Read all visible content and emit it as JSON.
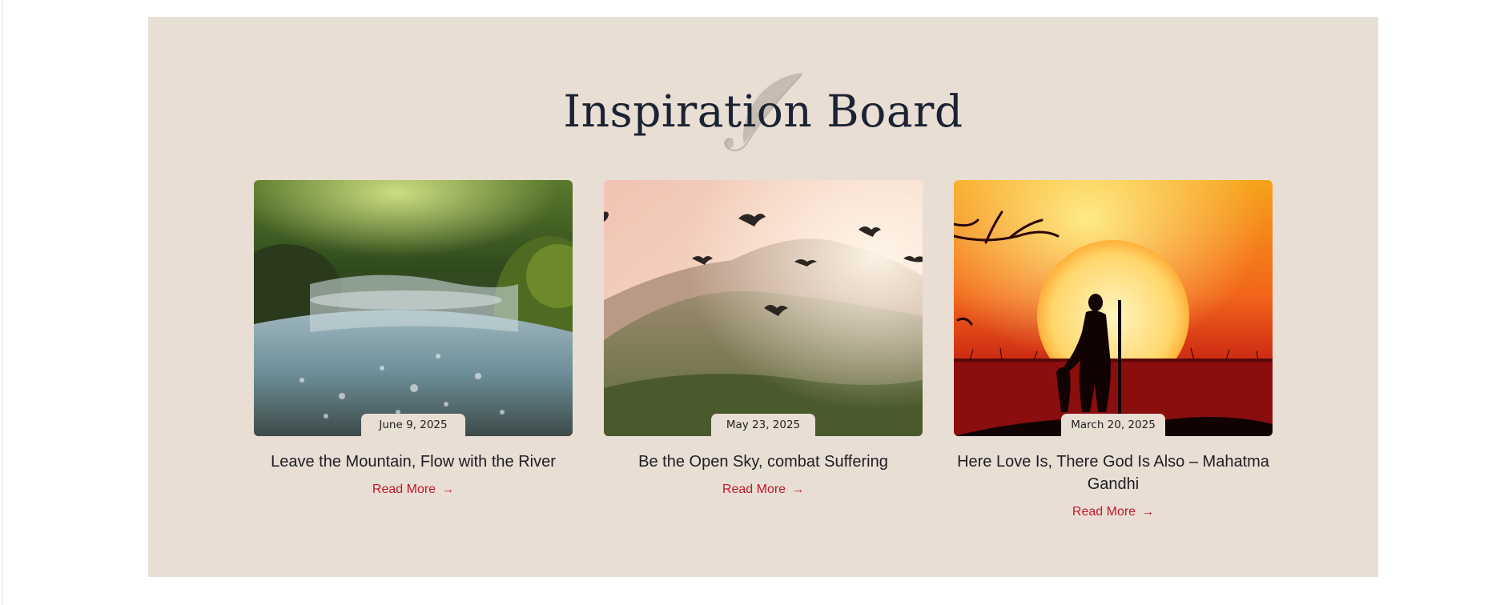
{
  "section": {
    "title": "Inspiration Board",
    "background": "#e9ded4",
    "title_color": "#1b2333",
    "accent_color": "#c2182b"
  },
  "cards": [
    {
      "date": "June 9, 2025",
      "title": "Leave the Mountain, Flow with the River",
      "link_label": "Read More",
      "arrow_icon": "arrow-right-icon"
    },
    {
      "date": "May 23, 2025",
      "title": "Be the Open Sky, combat Suffering",
      "link_label": "Read More",
      "arrow_icon": "arrow-right-icon"
    },
    {
      "date": "March 20, 2025",
      "title": "Here Love Is, There God Is Also – Mahatma Gandhi",
      "link_label": "Read More",
      "arrow_icon": "arrow-right-icon"
    }
  ]
}
